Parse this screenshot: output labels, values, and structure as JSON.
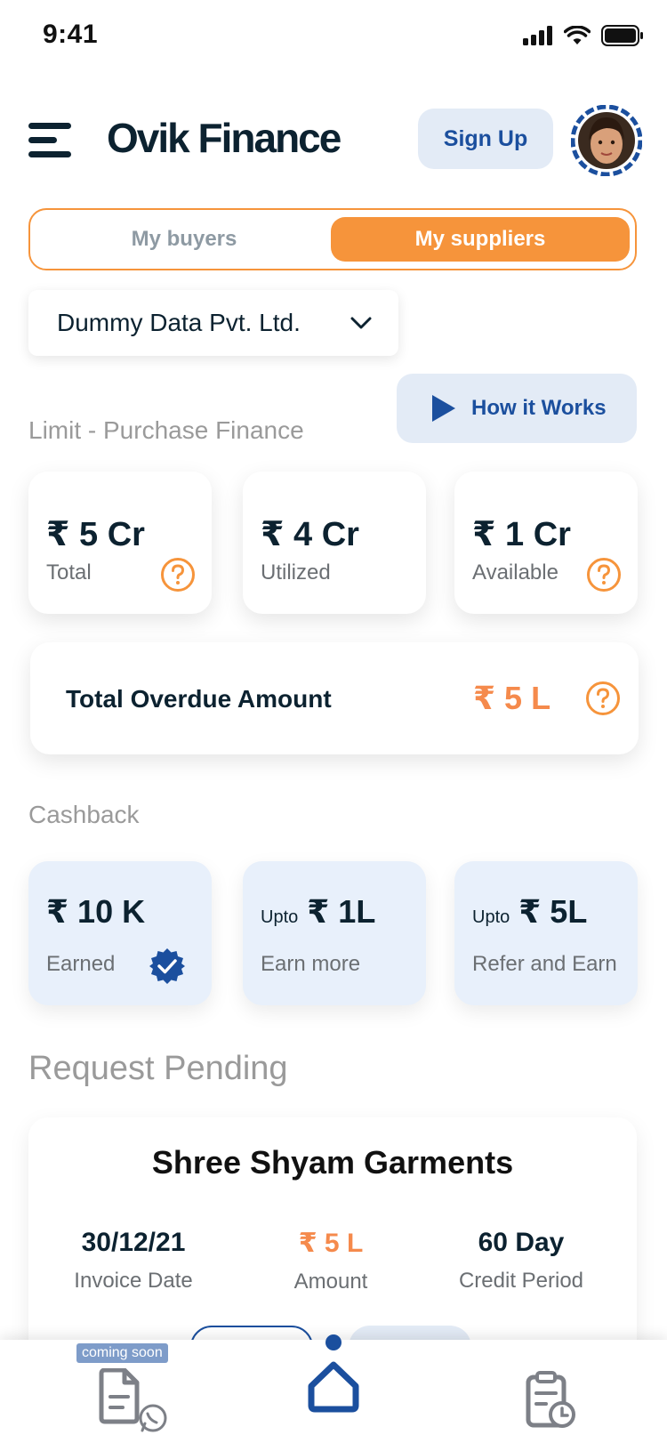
{
  "status_bar": {
    "time": "9:41"
  },
  "header": {
    "app_title": "Ovik Finance",
    "signup_label": "Sign Up"
  },
  "toggle": {
    "tabs": [
      "My buyers",
      "My suppliers"
    ],
    "active": "My suppliers"
  },
  "company": {
    "selected": "Dummy Data Pvt. Ltd."
  },
  "how_it_works": {
    "label": "How it Works"
  },
  "limit": {
    "title": "Limit - Purchase Finance",
    "cards": [
      {
        "value": "₹ 5 Cr",
        "label": "Total"
      },
      {
        "value": "₹ 4 Cr",
        "label": "Utilized"
      },
      {
        "value": "₹ 1 Cr",
        "label": "Available"
      }
    ]
  },
  "overdue": {
    "label": "Total Overdue Amount",
    "amount": "₹ 5 L"
  },
  "cashback": {
    "title": "Cashback",
    "cards": [
      {
        "prefix": "",
        "value": "₹ 10 K",
        "label": "Earned"
      },
      {
        "prefix": "Upto",
        "value": "₹ 1L",
        "label": "Earn more"
      },
      {
        "prefix": "Upto",
        "value": "₹ 5L",
        "label": "Refer and Earn"
      }
    ]
  },
  "request": {
    "title": "Request Pending",
    "card": {
      "name": "Shree Shyam Garments",
      "invoice_date": "30/12/21",
      "invoice_label": "Invoice Date",
      "amount": "₹ 5 L",
      "amount_label": "Amount",
      "credit": "60 Day",
      "credit_label": "Credit Period"
    }
  },
  "bottom_nav": {
    "badge": "coming soon",
    "items": [
      "document-whatsapp-icon",
      "home-icon",
      "clipboard-clock-icon"
    ]
  },
  "colors": {
    "accent_orange": "#f6943b",
    "brand_blue": "#1b4f9e",
    "dark": "#0c2230",
    "light_blue": "#e3ebf6"
  }
}
